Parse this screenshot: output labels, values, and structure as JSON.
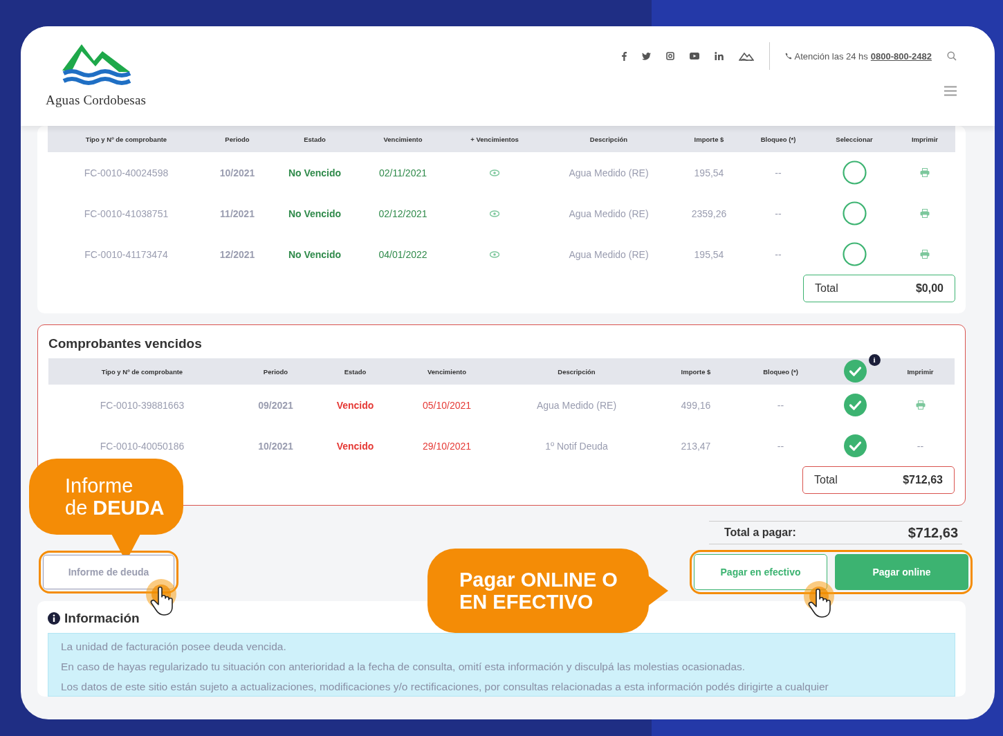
{
  "header": {
    "brand": "Aguas Cordobesas",
    "contact_label": "Atención las 24 hs",
    "phone": "0800-800-2482"
  },
  "current_invoices": {
    "columns": [
      "Tipo y Nº de comprobante",
      "Periodo",
      "Estado",
      "Vencimiento",
      "+ Vencimientos",
      "Descripción",
      "Importe $",
      "Bloqueo (*)",
      "Seleccionar",
      "Imprimir"
    ],
    "rows": [
      {
        "number": "FC-0010-40024598",
        "period": "10/2021",
        "status": "No Vencido",
        "overdue": false,
        "due": "02/11/2021",
        "description": "Agua Medido (RE)",
        "amount": "195,54",
        "block": "--",
        "selected": false,
        "printable": true
      },
      {
        "number": "FC-0010-41038751",
        "period": "11/2021",
        "status": "No Vencido",
        "overdue": false,
        "due": "02/12/2021",
        "description": "Agua Medido (RE)",
        "amount": "2359,26",
        "block": "--",
        "selected": false,
        "printable": true
      },
      {
        "number": "FC-0010-41173474",
        "period": "12/2021",
        "status": "No Vencido",
        "overdue": false,
        "due": "04/01/2022",
        "description": "Agua Medido (RE)",
        "amount": "195,54",
        "block": "--",
        "selected": false,
        "printable": true
      }
    ],
    "total": {
      "label": "Total",
      "value": "$0,00"
    }
  },
  "overdue_invoices": {
    "title": "Comprobantes vencidos",
    "columns": [
      "Tipo y Nº de comprobante",
      "Periodo",
      "Estado",
      "Vencimiento",
      "Descripción",
      "Importe $",
      "Bloqueo (*)",
      "Imprimir"
    ],
    "select_all_checked": true,
    "info_badge": "i",
    "rows": [
      {
        "number": "FC-0010-39881663",
        "period": "09/2021",
        "status": "Vencido",
        "overdue": true,
        "due": "05/10/2021",
        "description": "Agua Medido (RE)",
        "amount": "499,16",
        "block": "--",
        "selected": true,
        "printable": true,
        "print_text": ""
      },
      {
        "number": "FC-0010-40050186",
        "period": "10/2021",
        "status": "Vencido",
        "overdue": true,
        "due": "29/10/2021",
        "description": "1º Notif Deuda",
        "amount": "213,47",
        "block": "--",
        "selected": true,
        "printable": false,
        "print_text": "--"
      }
    ],
    "total": {
      "label": "Total",
      "value": "$712,63"
    }
  },
  "grand_total": {
    "label": "Total a pagar:",
    "value": "$712,63"
  },
  "debt_report_button": "Informe de deuda",
  "pay_buttons": [
    {
      "label": "Pagar en efectivo",
      "kind": "outline"
    },
    {
      "label": "Pagar online",
      "kind": "filled"
    }
  ],
  "info": {
    "title": "Información",
    "lines": [
      "La unidad de facturación posee deuda vencida.",
      "En caso de hayas regularizado tu situación con anterioridad a la fecha de consulta, omití esta información y disculpá las molestias ocasionadas.",
      "Los datos de este sitio están sujeto a actualizaciones, modificaciones y/o rectificaciones, por consultas relacionadas a esta información podés dirigirte a cualquier"
    ]
  },
  "callouts": [
    {
      "lines": [
        "Informe",
        "de **DEUDA**"
      ]
    },
    {
      "lines": [
        "Pagar **ONLINE O**",
        "**EN EFECTIVO**"
      ]
    }
  ]
}
